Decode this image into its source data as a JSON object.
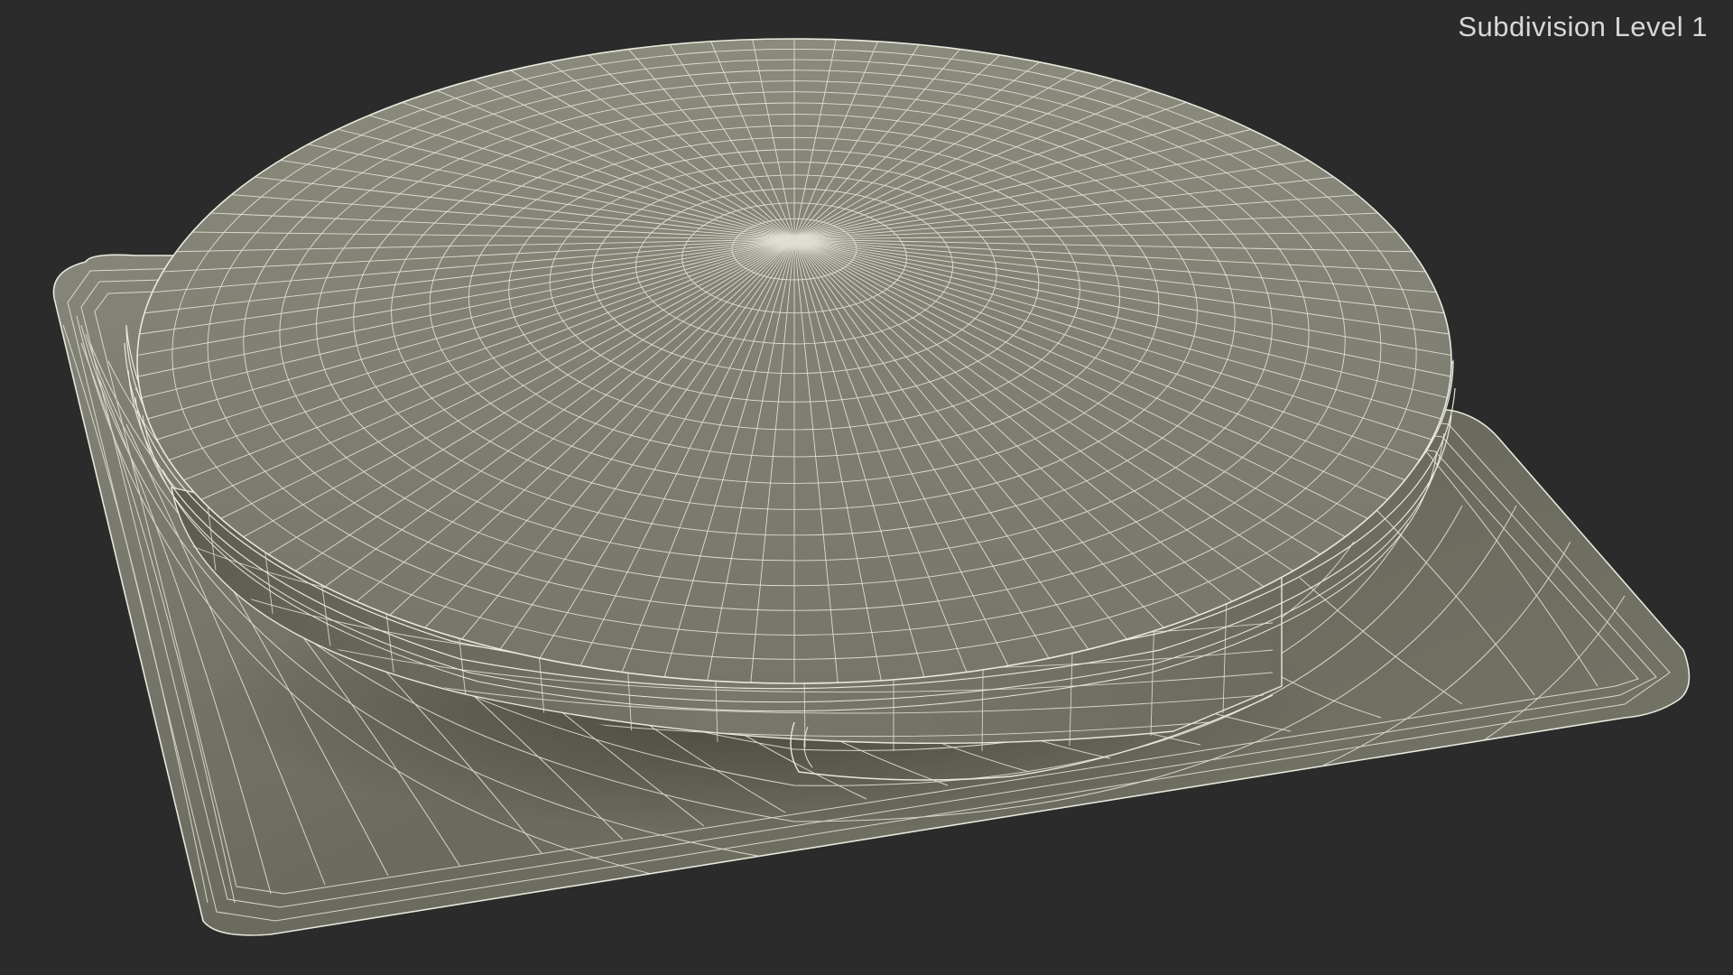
{
  "overlay": {
    "subdivision_label": "Subdivision Level 1"
  },
  "colors": {
    "background": "#2b2b2b",
    "surface": "#7c7c6e",
    "surface_shadow": "#5b5b50",
    "wire": "#e8e8dc"
  }
}
